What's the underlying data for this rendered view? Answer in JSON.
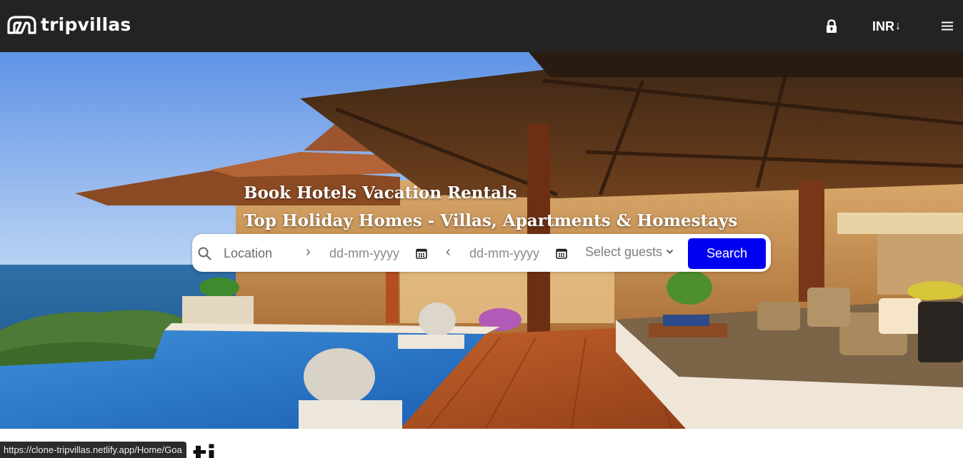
{
  "navbar": {
    "logo_text": "tripvillas",
    "currency_label": "INR",
    "currency_arrow": "↓",
    "icons": [
      "tripvillas-logo-icon",
      "lock-icon",
      "hamburger-menu-icon"
    ]
  },
  "hero": {
    "title_line1": "Book Hotels Vacation Rentals",
    "title_line2": "Top Holiday Homes - Villas, Apartments & Homestays",
    "image": "luxury-villa-pool-sea-view"
  },
  "search": {
    "location_placeholder": "Location",
    "checkin_placeholder": "dd-mm-yyyy",
    "checkout_placeholder": "dd-mm-yyyy",
    "guests_placeholder": "Select guests",
    "button_label": "Search",
    "icons": [
      "search-icon",
      "chevron-right-icon",
      "calendar-icon",
      "chevron-left-icon",
      "chevron-down-icon"
    ],
    "button_color": "#0000f0"
  },
  "page": {
    "partial_heading": "ti"
  },
  "status_bar": {
    "url": "https://clone-tripvillas.netlify.app/Home/Goa"
  },
  "colors": {
    "navbar_bg": "#232323",
    "accent": "#0000f0"
  }
}
